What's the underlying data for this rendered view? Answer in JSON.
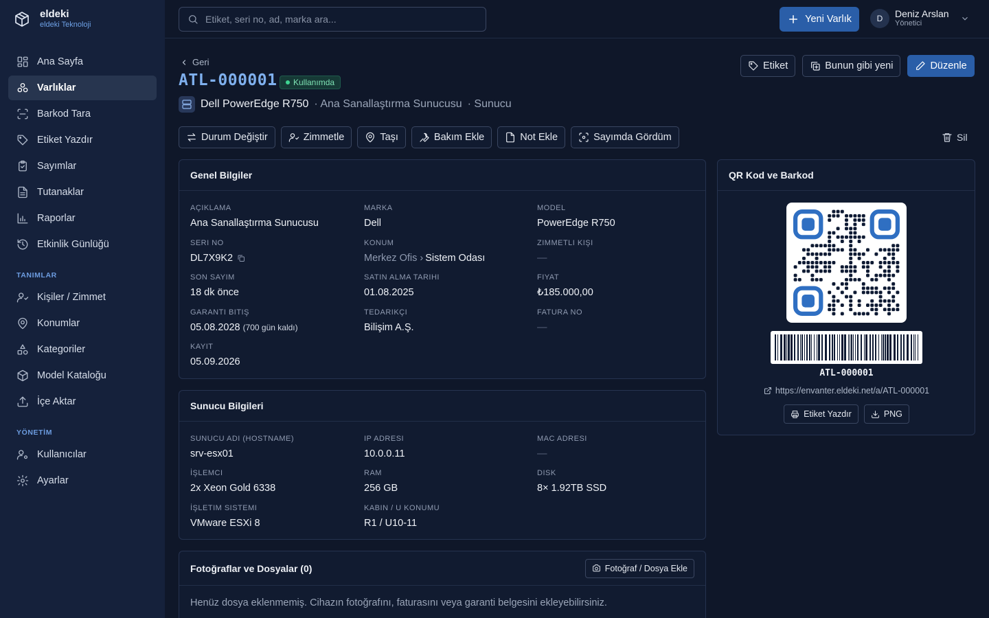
{
  "app": {
    "name": "eldeki",
    "org": "eldeki Teknoloji"
  },
  "sidebar": {
    "items": [
      {
        "label": "Ana Sayfa",
        "icon": "dashboard-icon",
        "active": false
      },
      {
        "label": "Varlıklar",
        "icon": "assets-icon",
        "active": true
      },
      {
        "label": "Barkod Tara",
        "icon": "scan-icon",
        "active": false
      },
      {
        "label": "Etiket Yazdır",
        "icon": "tag-icon",
        "active": false
      },
      {
        "label": "Sayımlar",
        "icon": "clipboard-icon",
        "active": false
      },
      {
        "label": "Tutanaklar",
        "icon": "document-icon",
        "active": false
      },
      {
        "label": "Raporlar",
        "icon": "bar-chart-icon",
        "active": false
      },
      {
        "label": "Etkinlik Günlüğü",
        "icon": "history-icon",
        "active": false
      }
    ],
    "section_definitions": "TANIMLAR",
    "definitions": [
      {
        "label": "Kişiler / Zimmet",
        "icon": "users-icon"
      },
      {
        "label": "Konumlar",
        "icon": "map-pin-icon"
      },
      {
        "label": "Kategoriler",
        "icon": "shapes-icon"
      },
      {
        "label": "Model Kataloğu",
        "icon": "package-icon"
      },
      {
        "label": "İçe Aktar",
        "icon": "upload-icon"
      }
    ],
    "section_admin": "YÖNETİM",
    "admin": [
      {
        "label": "Kullanıcılar",
        "icon": "user-cog-icon"
      },
      {
        "label": "Ayarlar",
        "icon": "settings-icon"
      }
    ]
  },
  "topbar": {
    "search_placeholder": "Etiket, seri no, ad, marka ara...",
    "new_button": "Yeni Varlık",
    "user": {
      "initial": "D",
      "name": "Deniz Arslan",
      "role": "Yönetici"
    }
  },
  "asset": {
    "back_label": "Geri",
    "id": "ATL-000001",
    "status": "Kullanımda",
    "model": "Dell PowerEdge R750",
    "description_suffix": "· Ana Sanallaştırma Sunucusu",
    "category_suffix": "· Sunucu"
  },
  "header_actions": {
    "tag": "Etiket",
    "clone": "Bunun gibi yeni",
    "edit": "Düzenle"
  },
  "actions": {
    "change_status": "Durum Değiştir",
    "assign": "Zimmetle",
    "move": "Taşı",
    "add_maintenance": "Bakım Ekle",
    "add_note": "Not Ekle",
    "seen_in_count": "Sayımda Gördüm",
    "delete": "Sil"
  },
  "general": {
    "title": "Genel Bilgiler",
    "description": {
      "label": "Açıklama",
      "value": "Ana Sanallaştırma Sunucusu"
    },
    "brand": {
      "label": "Marka",
      "value": "Dell"
    },
    "model": {
      "label": "Model",
      "value": "PowerEdge R750"
    },
    "serial": {
      "label": "Seri No",
      "value": "DL7X9K2"
    },
    "location": {
      "label": "Konum",
      "parent": "Merkez Ofis ›",
      "value": "Sistem Odası"
    },
    "assignee": {
      "label": "Zimmetli Kişi",
      "value": "—"
    },
    "last_count": {
      "label": "Son Sayım",
      "value": "18 dk önce"
    },
    "purchase_date": {
      "label": "Satın Alma Tarihi",
      "value": "01.08.2025"
    },
    "price": {
      "label": "Fiyat",
      "value": "₺185.000,00"
    },
    "warranty": {
      "label": "Garanti Bitiş",
      "value": "05.08.2028",
      "remaining": "(700 gün kaldı)"
    },
    "supplier": {
      "label": "Tedarikçi",
      "value": "Bilişim A.Ş."
    },
    "invoice": {
      "label": "Fatura No",
      "value": "—"
    },
    "record": {
      "label": "Kayıt",
      "value": "05.09.2026"
    }
  },
  "server": {
    "title": "Sunucu Bilgileri",
    "hostname": {
      "label": "Sunucu Adı (Hostname)",
      "value": "srv-esx01"
    },
    "ip": {
      "label": "IP Adresi",
      "value": "10.0.0.11"
    },
    "mac": {
      "label": "MAC Adresi",
      "value": "—"
    },
    "cpu": {
      "label": "İşlemci",
      "value": "2x Xeon Gold 6338"
    },
    "ram": {
      "label": "RAM",
      "value": "256 GB"
    },
    "disk": {
      "label": "Disk",
      "value": "8× 1.92TB SSD"
    },
    "os": {
      "label": "İşletim Sistemi",
      "value": "VMware ESXi 8"
    },
    "rack": {
      "label": "Kabin / U Konumu",
      "value": "R1 / U10-11"
    }
  },
  "files": {
    "title": "Fotoğraflar ve Dosyalar (0)",
    "add_button": "Fotoğraf / Dosya Ekle",
    "empty": "Henüz dosya eklenmemiş. Cihazın fotoğrafını, faturasını veya garanti belgesini ekleyebilirsiniz."
  },
  "qr": {
    "title": "QR Kod ve Barkod",
    "code": "ATL-000001",
    "url": "https://envanter.eldeki.net/a/ATL-000001",
    "print_button": "Etiket Yazdır",
    "png_button": "PNG"
  },
  "colors": {
    "accent": "#2a5ea8",
    "background": "#0f1729",
    "sidebar": "#15213b",
    "status_green": "#3fd592",
    "id_blue": "#7fb0ee"
  }
}
